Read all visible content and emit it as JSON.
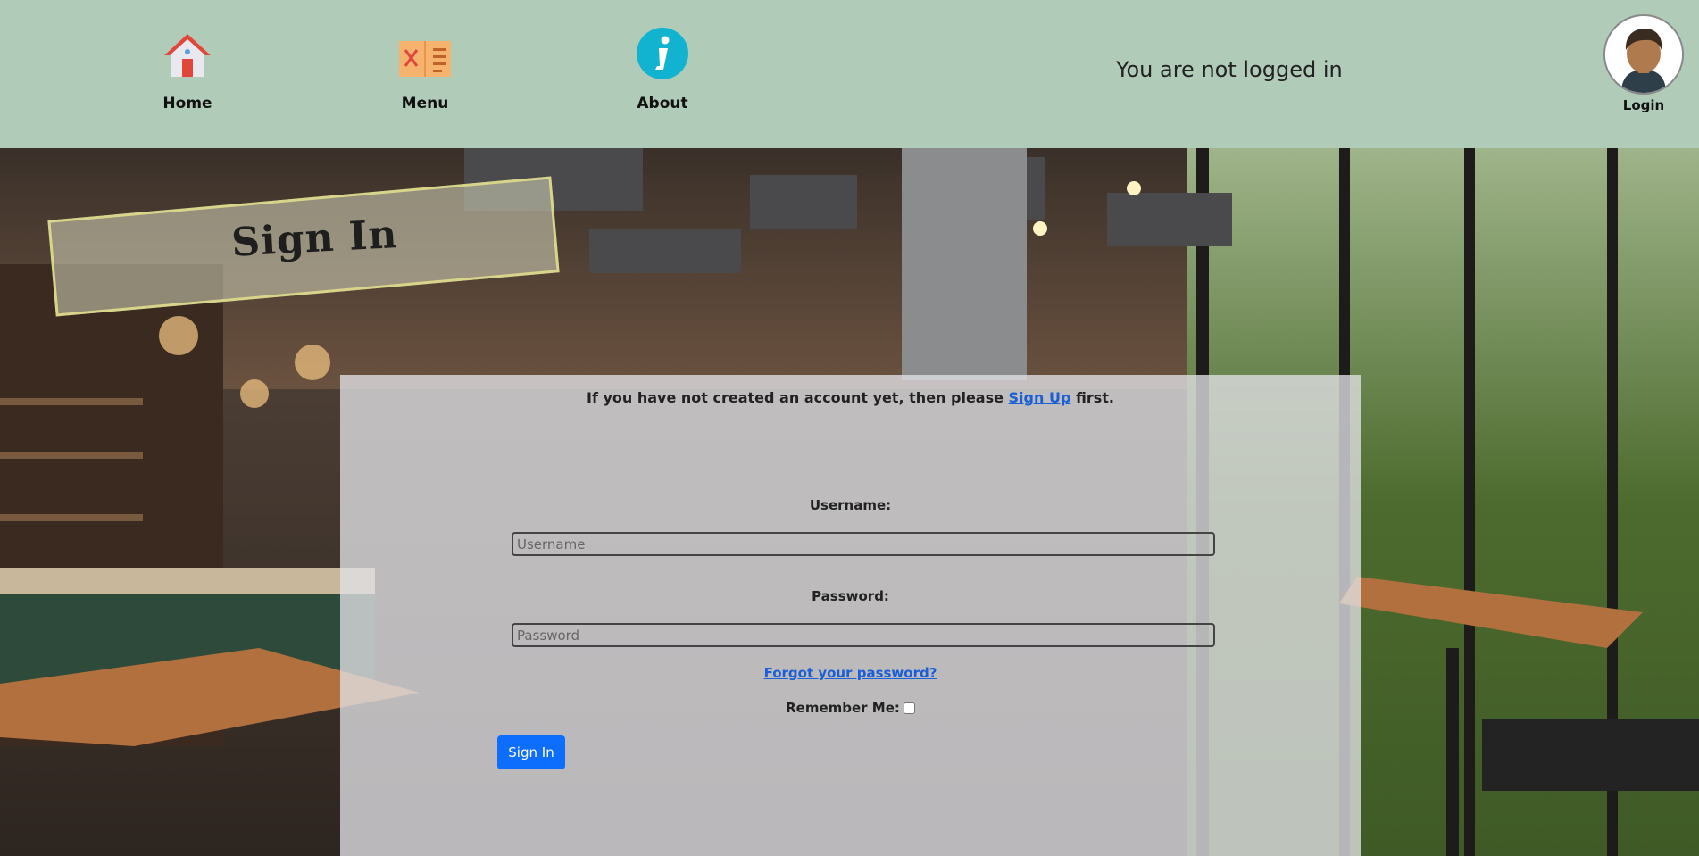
{
  "nav": {
    "items": [
      {
        "label": "Home",
        "icon": "house-icon"
      },
      {
        "label": "Menu",
        "icon": "menu-book-icon"
      },
      {
        "label": "About",
        "icon": "info-icon"
      }
    ]
  },
  "status": {
    "text": "You are not logged in"
  },
  "login": {
    "label": "Login",
    "icon": "user-avatar-icon"
  },
  "banner": {
    "title": "Sign In"
  },
  "form": {
    "signup_prefix": "If you have not created an account yet, then please ",
    "signup_link": "Sign Up",
    "signup_suffix": " first.",
    "username_label": "Username:",
    "username_placeholder": "Username",
    "username_value": "",
    "password_label": "Password:",
    "password_placeholder": "Password",
    "password_value": "",
    "forgot_link": "Forgot your password?",
    "remember_label": "Remember Me:",
    "remember_checked": false,
    "submit_label": "Sign In"
  },
  "colors": {
    "header_bg": "#b1cbb9",
    "link": "#1a5fd6",
    "primary_button": "#0d6efd"
  }
}
